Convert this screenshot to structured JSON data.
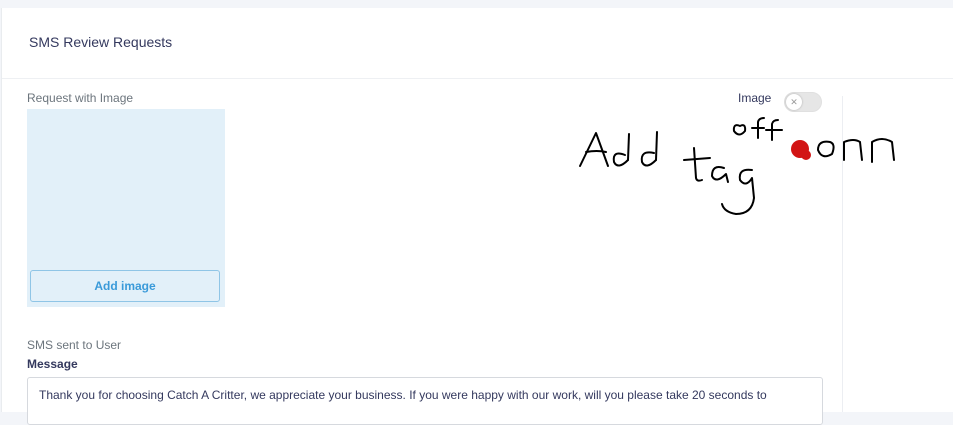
{
  "header": {
    "title": "SMS Review Requests"
  },
  "image_request": {
    "label": "Request with Image",
    "add_image_label": "Add image",
    "toggle_label": "Image",
    "toggle_state": "off",
    "toggle_icon": "x-icon"
  },
  "annotation": {
    "text": "Add tag",
    "handwritten_options": "off | on"
  },
  "sms": {
    "section_label": "SMS sent to User",
    "message_label": "Message",
    "message_value": "Thank you for choosing Catch A Critter, we appreciate your business. If you were happy with our work, will you please take 20 seconds to"
  },
  "colors": {
    "accent": "#3a9ad9",
    "image_box": "#e2f0f9",
    "annotation_marker": "#d21414"
  }
}
